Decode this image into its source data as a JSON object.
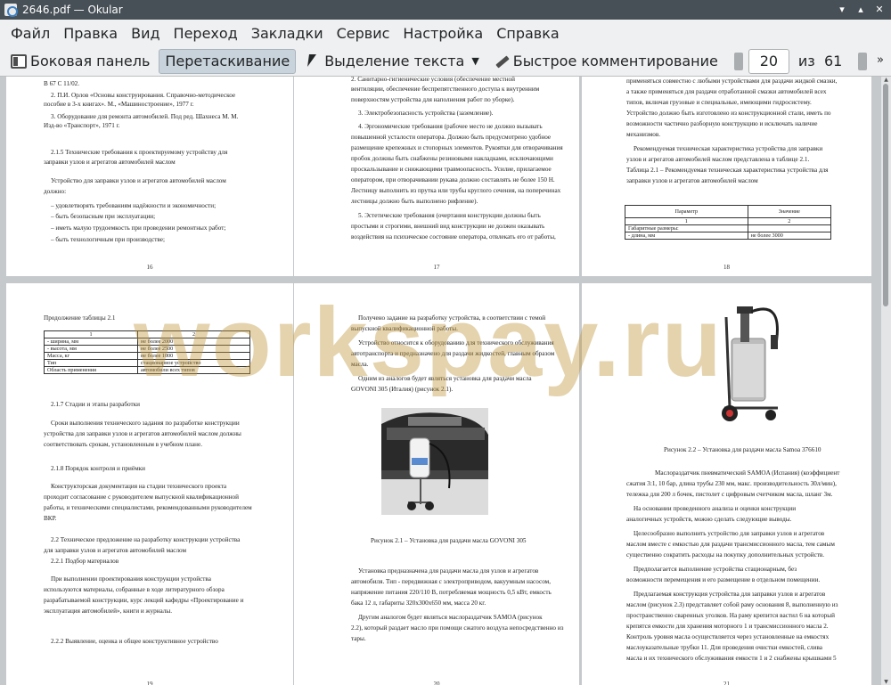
{
  "window": {
    "title": "2646.pdf — Okular"
  },
  "menu": [
    "Файл",
    "Правка",
    "Вид",
    "Переход",
    "Закладки",
    "Сервис",
    "Настройка",
    "Справка"
  ],
  "toolbar": {
    "sidebar_label": "Боковая панель",
    "drag_label": "Перетаскивание",
    "select_label": "Выделение текста",
    "comment_label": "Быстрое комментирование",
    "page_value": "20",
    "of_label": "из",
    "total_pages": "61"
  },
  "watermark": "workspay.ru",
  "pages": {
    "p16": {
      "number": "16",
      "lines": [
        "В 67 С 11/02.",
        "2. П.И. Орлов «Основы конструирования. Справочно-методическое",
        "пособие в 3-х книгах». М., «Машиностроение», 1977 г.",
        "3. Оборудование для ремонта автомобилей. Под ред. Шахнеса М. М.",
        "Изд-во «Транспорт», 1971 г.",
        "2.1.5  Технические  требования  к  проектируемому  устройству  для",
        "заправки узлов и агрегатов автомобилей маслом",
        "Устройство  для  заправки  узлов  и  агрегатов  автомобилей  маслом",
        "должно:",
        "–  удовлетворять требованиям надёжности и экономичности;",
        "–  быть безопасным при эксплуатации;",
        "–  иметь малую трудоемкость при проведении ремонтных работ;",
        "–  быть технологичным при производстве;"
      ]
    },
    "p17": {
      "number": "17",
      "lines": [
        "2. Санитарно-гигиенические        условия        (обеспечение        местной",
        "вентиляции,  обеспечение  беспрепятственного  доступа  к  внутренним",
        "поверхностям устройства для наполнения работ по уборке).",
        "3. Электробезопасность устройства (заземление).",
        "4. Эргономические  требования  (рабочее  место  не  должно  вызывать",
        "повышенной усталости оператора. Должно быть предусмотрено удобное",
        "размещение крепежных и стопорных элементов. Рукоятки для отворачивания",
        "пробок должны быть снабжены резиновыми накладками, исключающими",
        "проскальзывание и снижающими травмоопасность.  Усилие,  прилагаемое",
        "оператором, при отворачивании рукава должно составлять не более 150 Н.",
        "Лестницу выполнить из прутка или трубы круглого сечения, на поперечинах",
        "лестницы должно быть выполнено рифление).",
        "5. Эстетические  требования  (очертания  конструкции  должны  быть",
        "простыми  и  строгими,  внешний  вид  конструкции  не  должен  оказывать",
        "воздействия на психическое состояние оператора, отвлекать его от работы,"
      ]
    },
    "p18": {
      "number": "18",
      "lines": [
        "применяться совместно с любыми устройствами для раздачи жидкой смазки,",
        "а  также  применяться  для  раздачи  отработанной  смазки  автомобилей  всех",
        "типов,  включая  грузовые  и  специальные,  имеющими  гидросистему.",
        "Устройство  должно  быть  изготовлено  из  конструкционной  стали,  иметь  по",
        "возможности  частично  разборную  конструкцию  и  исключать  наличие",
        "механизмов.",
        "Рекомендуемая техническая характеристика устройства для заправки",
        "узлов и агрегатов автомобилей маслом представлена в таблице 2.1.",
        "Таблица 2.1 – Рекомендуемая техническая характеристика устройства для",
        "заправки узлов и агрегатов автомобилей маслом"
      ],
      "table": [
        [
          "Параметр",
          "Значение"
        ],
        [
          "1",
          "2"
        ],
        [
          "Габаритные размеры:",
          ""
        ],
        [
          "- длина, мм",
          "не более 3000"
        ]
      ]
    },
    "p19": {
      "number": "19",
      "title": "Продолжение таблицы 2.1",
      "table": [
        [
          "1",
          "2"
        ],
        [
          "- ширина, мм",
          "не более 2000"
        ],
        [
          "- высота, мм",
          "не более 2500"
        ],
        [
          "Масса, кг",
          "не более 1000"
        ],
        [
          "Тип",
          "стационарное устройство"
        ],
        [
          "Область применения",
          "автомобили всех типов"
        ]
      ],
      "lines": [
        "2.1.7 Стадии и этапы разработки",
        "Сроки  выполнения  технического  задания  по  разработке  конструкции",
        "устройства  для  заправки  узлов  и  агрегатов  автомобилей  маслом  должны",
        "соответствовать срокам, установленным в учебном плане.",
        "2.1.8 Порядок контроля и приёмки",
        "Конструкторская  документация  на  стадии  технического  проекта",
        "проходит  согласование  с  руководителем  выпускной  квалификационной",
        "работы, и техническими специалистами, рекомендованными руководителем",
        "ВКР.",
        "2.2 Техническое предложение на разработку конструкции устройства",
        "для заправки узлов и агрегатов автомобилей маслом",
        "2.2.1 Подбор материалов",
        "При   выполнении   проектирования   конструкции   устройства",
        "используются  материалы,  собранные  в  ходе  литературного  обзора",
        "разрабатываемой  конструкции,  курс  лекций  кафедры  «Проектирование  и",
        "эксплуатация автомобилей», книги и журналы.",
        "2.2.2 Выявление, оценка и общее конструктивное устройство"
      ]
    },
    "p20": {
      "number": "20",
      "lines_top": [
        "Получено задание на разработку устройства, в соответствии с темой",
        "выпускной квалификационной работы.",
        "Устройство относится к оборудованию для технического обслуживания",
        "автотранспорта и предназначено для раздачи жидкостей, главным образом",
        "масла.",
        "Одним  из  аналогов  будет  являться  установка  для  раздачи  масла",
        "GOVONI 305 (Италия) (рисунок 2.1)."
      ],
      "caption": "Рисунок 2.1 – Установка для раздачи масла GOVONI 305",
      "lines_bottom": [
        "Установка предназначена для раздачи масла для узлов и агрегатов",
        "автомобиля.  Тип - передвижная с электроприводом, вакуумным насосом,",
        "напряжение  питания  220/110 В,  потребляемая  мощность  0,5 кВт,  емкость",
        "бака 12 л, габариты 320х300х650 мм, масса 20 кг.",
        "Другим  аналогом  будет  являться  маслораздатчик  SAMOA  (рисунок",
        "2.2), который раздает масло при помощи сжатого воздуха непосредственно из",
        "тары."
      ]
    },
    "p21": {
      "number": "21",
      "caption": "Рисунок 2.2 – Установка для раздачи масла Samoa 376610",
      "lines": [
        "Маслораздатчик  пневматический  SAMOA  (Испания)  (коэффициент",
        "сжатия 3:1, 10 бар, длина трубы 230 мм, макс. производительность 30л/мин),",
        "тележка для 200 л бочек, пистолет с цифровым счетчиком масла, шланг 3м.",
        "На   основании   проведенного   анализа   и   оценки   конструкции",
        "аналогичных устройств, можно сделать следующие выводы.",
        "Целесообразно выполнить устройство для заправки узлов и агрегатов",
        "маслом вместе с емкостью для раздачи трансмиссионного масла, тем самым",
        "существенно сократить расходы на покупку дополнительных устройств.",
        "Предполагается     выполнение     устройства     стационарным,     без",
        "возможности перемещения и его размещение в отдельном помещении.",
        "Предлагаемая конструкция устройства для заправки узлов и агрегатов",
        "маслом (рисунок 2.3) представляет собой раму основания 8, выполненную из",
        "пространственно сваренных уголков. На раму крепится вастил 6 на который",
        "крепятся емкости для хранения моторного 1 и трансмиссионного масла 2.",
        "Контроль уровня масла осуществляется через установленные на емкостях",
        "маслоуказательные трубки 11. Для проведения очистки емкостей, слива",
        "масла и их технического обслуживания емкости 1 и 2 снабжены крышками 5"
      ]
    }
  }
}
